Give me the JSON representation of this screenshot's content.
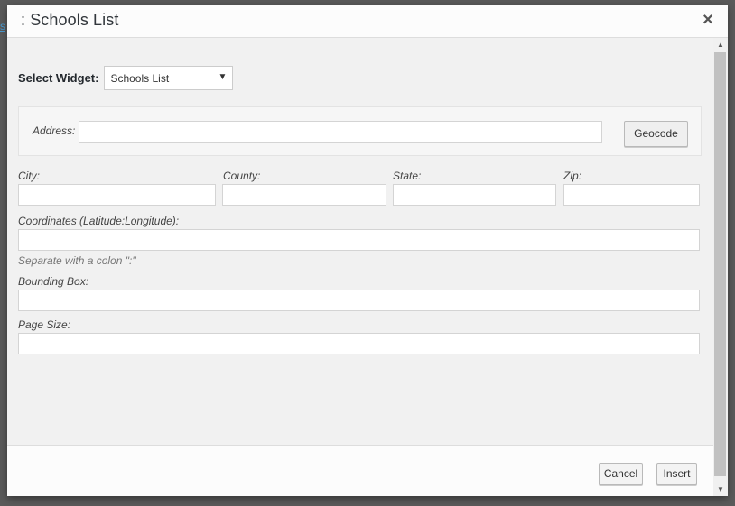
{
  "dialog": {
    "title": ": Schools List",
    "close_glyph": "×"
  },
  "widget": {
    "label": "Select Widget:",
    "selected": "Schools List",
    "arrow_glyph": "▼"
  },
  "address": {
    "label": "Address:",
    "value": "",
    "geocode_label": "Geocode"
  },
  "fields": {
    "city": {
      "label": "City:",
      "value": ""
    },
    "county": {
      "label": "County:",
      "value": ""
    },
    "state": {
      "label": "State:",
      "value": ""
    },
    "zip": {
      "label": "Zip:",
      "value": ""
    },
    "coordinates": {
      "label": "Coordinates (Latitude:Longitude):",
      "value": "",
      "hint": "Separate with a colon \":\""
    },
    "bounding_box": {
      "label": "Bounding Box:",
      "value": ""
    },
    "page_size": {
      "label": "Page Size:",
      "value": ""
    }
  },
  "footer": {
    "cancel_label": "Cancel",
    "insert_label": "Insert"
  },
  "scrollbar": {
    "up_glyph": "▲",
    "down_glyph": "▼"
  },
  "backdrop": {
    "link_fragment": "s"
  },
  "colors": {
    "header_bg": "#fcfcfc",
    "body_bg": "#f1f1f1",
    "overlay": "#5a5a5a",
    "link": "#4a9ad0"
  }
}
